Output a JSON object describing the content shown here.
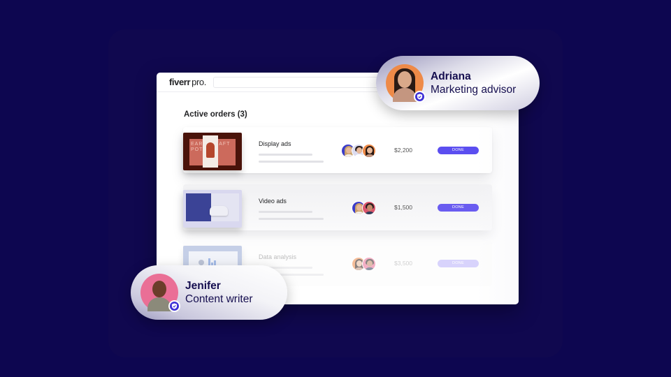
{
  "app": {
    "logo_main": "fiverr",
    "logo_suffix": "pro."
  },
  "search": {
    "placeholder": ""
  },
  "orders": {
    "title": "Active orders (3)",
    "items": [
      {
        "name": "Display ads",
        "price": "$2,200",
        "status": "DONE",
        "thumbnail": "earth-craft-pottery-thumbnail",
        "thumbnail_text": "EART  AFT\nPOT",
        "avatars": [
          "freelancer-blonde",
          "freelancer-man",
          "freelancer-brunette"
        ]
      },
      {
        "name": "Video ads",
        "price": "$1,500",
        "status": "DONE",
        "thumbnail": "vr-headset-thumbnail",
        "avatars": [
          "freelancer-blonde",
          "freelancer-man-pink"
        ]
      },
      {
        "name": "Data analysis",
        "price": "$3,500",
        "status": "DONE",
        "thumbnail": "dashboard-chart-thumbnail",
        "avatars": [
          "freelancer-brunette",
          "freelancer-man-pink"
        ]
      }
    ]
  },
  "profiles": [
    {
      "name": "Adriana",
      "role": "Marketing advisor",
      "avatar_color": "#ee8a48",
      "verified": true
    },
    {
      "name": "Jenifer",
      "role": "Content writer",
      "avatar_color": "#ea6f96",
      "verified": true
    }
  ],
  "colors": {
    "background": "#0d0650",
    "status_done": "#5b4ef0",
    "verified_badge": "#3d2fd6",
    "profile_text": "#150e4f"
  }
}
